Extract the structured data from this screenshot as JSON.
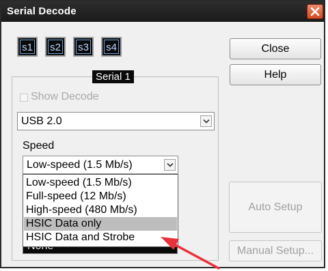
{
  "window": {
    "title": "Serial Decode"
  },
  "serial_buttons": [
    "s1",
    "s2",
    "s3",
    "s4"
  ],
  "group": {
    "title": "Serial 1"
  },
  "show_decode": {
    "label": "Show Decode",
    "checked": false
  },
  "protocol": {
    "value": "USB 2.0"
  },
  "speed": {
    "label": "Speed",
    "value": "Low-speed (1.5 Mb/s)",
    "options": [
      "Low-speed (1.5 Mb/s)",
      "Full-speed (12 Mb/s)",
      "High-speed (480 Mb/s)",
      "HSIC Data only",
      "HSIC Data and Strobe"
    ],
    "highlighted_option": "HSIC Data only"
  },
  "hidden_combo": {
    "value": "None"
  },
  "buttons": {
    "close": "Close",
    "help": "Help",
    "auto_setup": "Auto Setup",
    "manual_setup": "Manual Setup..."
  },
  "colors": {
    "title_bar": "#1f1f1f",
    "close_x": "#e05a30",
    "serial_button_border": "#6fa3d8",
    "highlight": "#bdbdbd",
    "annotation_arrow": "#e8323c"
  }
}
